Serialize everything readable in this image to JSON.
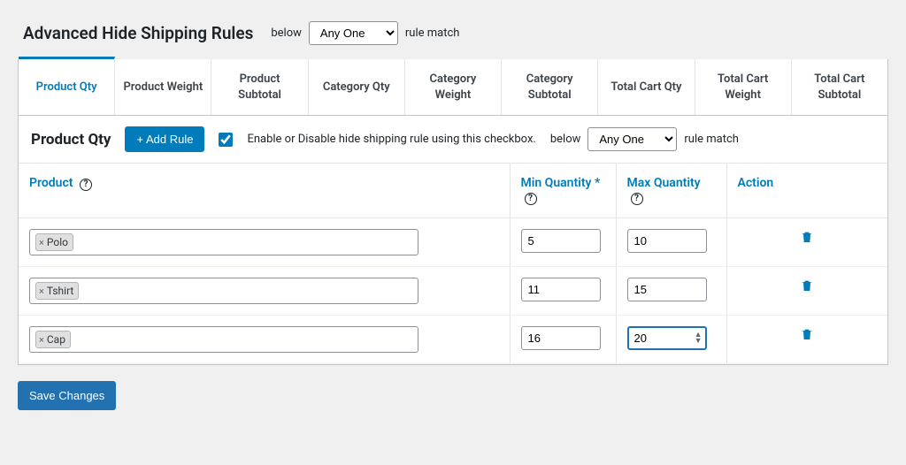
{
  "header": {
    "title": "Advanced Hide Shipping Rules",
    "below_label": "below",
    "match_label": "rule match",
    "select_value": "Any One"
  },
  "tabs": [
    "Product Qty",
    "Product Weight",
    "Product Subtotal",
    "Category Qty",
    "Category Weight",
    "Category Subtotal",
    "Total Cart Qty",
    "Total Cart Weight",
    "Total Cart Subtotal"
  ],
  "panel": {
    "title": "Product Qty",
    "add_rule_label": "+ Add Rule",
    "enable_label": "Enable or Disable hide shipping rule using this checkbox.",
    "below_label": "below",
    "match_label": "rule match",
    "select_value": "Any One"
  },
  "columns": {
    "product": "Product",
    "min": "Min Quantity *",
    "max": "Max Quantity",
    "action": "Action"
  },
  "rows": [
    {
      "product": "Polo",
      "min": "5",
      "max": "10",
      "focused": false
    },
    {
      "product": "Tshirt",
      "min": "11",
      "max": "15",
      "focused": false
    },
    {
      "product": "Cap",
      "min": "16",
      "max": "20",
      "focused": true
    }
  ],
  "save_label": "Save Changes"
}
